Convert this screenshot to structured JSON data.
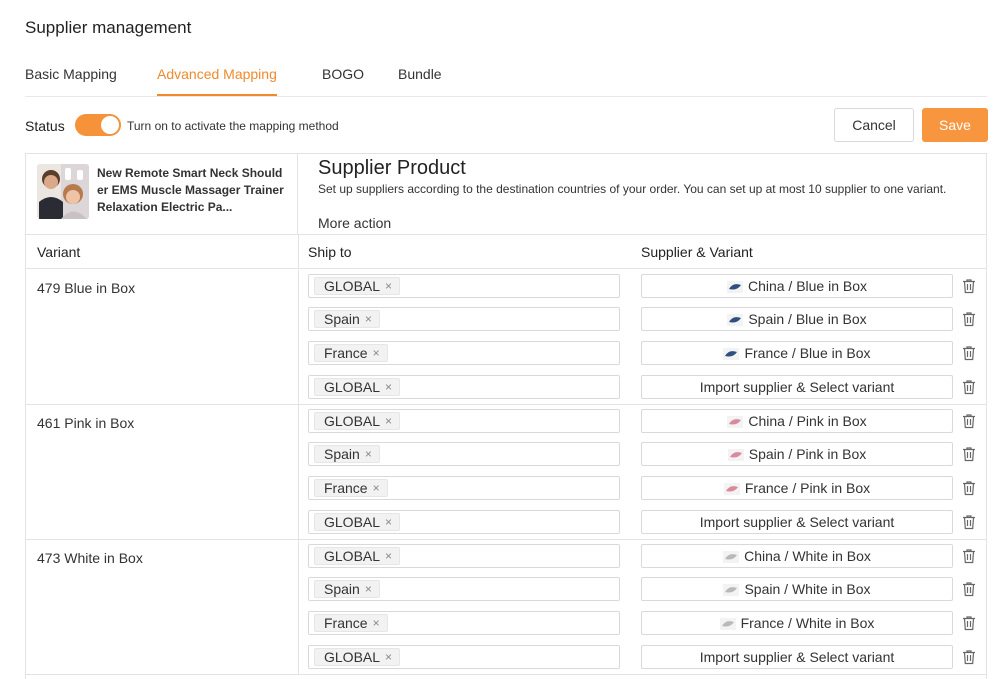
{
  "page": {
    "title": "Supplier management"
  },
  "tabs": [
    {
      "label": "Basic Mapping",
      "active": false
    },
    {
      "label": "Advanced Mapping",
      "active": true
    },
    {
      "label": "BOGO",
      "active": false
    },
    {
      "label": "Bundle",
      "active": false
    }
  ],
  "status": {
    "label": "Status",
    "enabled": true,
    "hint": "Turn on to activate the mapping method"
  },
  "actions": {
    "cancel_label": "Cancel",
    "save_label": "Save"
  },
  "colors": {
    "accent": "#f7963f",
    "border": "#e3e3e3"
  },
  "product": {
    "name": "New Remote Smart Neck Shoulder EMS Muscle Massager Trainer Relaxation Electric Pa...",
    "thumbnail_icon": "product-photo"
  },
  "supplier_product": {
    "title": "Supplier Product",
    "description": "Set up suppliers according to the destination countries of your order. You can set up at most 10 supplier to one variant.",
    "more_action": "More action"
  },
  "columns": {
    "variant": "Variant",
    "ship_to": "Ship to",
    "supplier_variant": "Supplier & Variant"
  },
  "variants": [
    {
      "name": "479 Blue in Box",
      "rows": [
        {
          "ship_to": "GLOBAL",
          "supplier": "China / Blue in Box"
        },
        {
          "ship_to": "Spain",
          "supplier": "Spain / Blue in Box"
        },
        {
          "ship_to": "France",
          "supplier": "France / Blue in Box"
        },
        {
          "ship_to": "GLOBAL",
          "supplier": "Import supplier & Select variant"
        }
      ]
    },
    {
      "name": "461 Pink in Box",
      "rows": [
        {
          "ship_to": "GLOBAL",
          "supplier": "China / Pink in Box"
        },
        {
          "ship_to": "Spain",
          "supplier": "Spain / Pink in Box"
        },
        {
          "ship_to": "France",
          "supplier": "France / Pink in Box"
        },
        {
          "ship_to": "GLOBAL",
          "supplier": "Import supplier & Select variant"
        }
      ]
    },
    {
      "name": "473 White in Box",
      "rows": [
        {
          "ship_to": "GLOBAL",
          "supplier": "China / White in Box"
        },
        {
          "ship_to": "Spain",
          "supplier": "Spain / White in Box"
        },
        {
          "ship_to": "France",
          "supplier": "France / White in Box"
        },
        {
          "ship_to": "GLOBAL",
          "supplier": "Import supplier & Select variant"
        }
      ]
    }
  ],
  "tag_remove_glyph": "×"
}
